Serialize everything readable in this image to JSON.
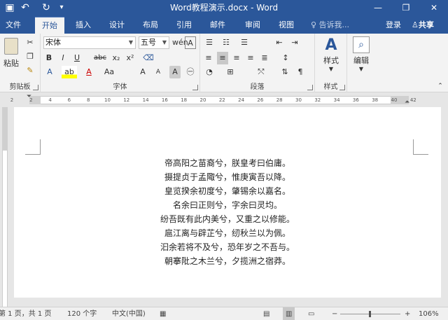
{
  "window": {
    "title": "Word教程演示.docx - Word",
    "min_icon": "minimize-icon",
    "max_icon": "maximize-icon",
    "close_icon": "close-icon"
  },
  "quick_access": [
    {
      "name": "save-icon",
      "glyph": "▣"
    },
    {
      "name": "undo-icon",
      "glyph": "↶"
    },
    {
      "name": "redo-icon",
      "glyph": "↻"
    }
  ],
  "tabs": [
    "文件",
    "开始",
    "插入",
    "设计",
    "布局",
    "引用",
    "邮件",
    "审阅",
    "视图"
  ],
  "active_tab": "开始",
  "tell_me": "告诉我...",
  "login": "登录",
  "share": "共享",
  "ribbon": {
    "clipboard": {
      "label": "剪贴板",
      "paste": "粘贴"
    },
    "font": {
      "label": "字体",
      "font_name": "宋体",
      "font_size": "五号",
      "row2": [
        "B",
        "I",
        "U",
        "abc",
        "x₂",
        "x²"
      ],
      "row3": [
        "A",
        "ab",
        "A",
        "Aa",
        "A",
        "A",
        "A"
      ],
      "change_case": "Aa"
    },
    "paragraph": {
      "label": "段落"
    },
    "styles": {
      "label": "样式",
      "button": "样式"
    },
    "editing": {
      "button": "编辑"
    }
  },
  "ruler_ticks": [
    "2",
    "2",
    "4",
    "6",
    "8",
    "10",
    "12",
    "14",
    "16",
    "18",
    "20",
    "22",
    "24",
    "26",
    "28",
    "30",
    "32",
    "34",
    "36",
    "38",
    "40",
    "42"
  ],
  "document": {
    "lines": [
      "帝高阳之苗裔兮，朕皇考曰伯庸。",
      "摄提贞于孟陬兮，惟庚寅吾以降。",
      "皇览揆余初度兮，肇锡余以嘉名。",
      "名余曰正则兮，字余曰灵均。",
      "纷吾既有此内美兮，又重之以修能。",
      "扈江离与辟芷兮，纫秋兰以为佩。",
      "汩余若将不及兮，恐年岁之不吾与。",
      "朝搴阰之木兰兮，夕揽洲之宿莽。"
    ]
  },
  "status": {
    "page": "第 1 页，共 1 页",
    "words": "120 个字",
    "language": "中文(中国)",
    "zoom": "106%"
  },
  "colors": {
    "accent": "#2b579a",
    "ribbon_bg": "#f3f3f3"
  }
}
